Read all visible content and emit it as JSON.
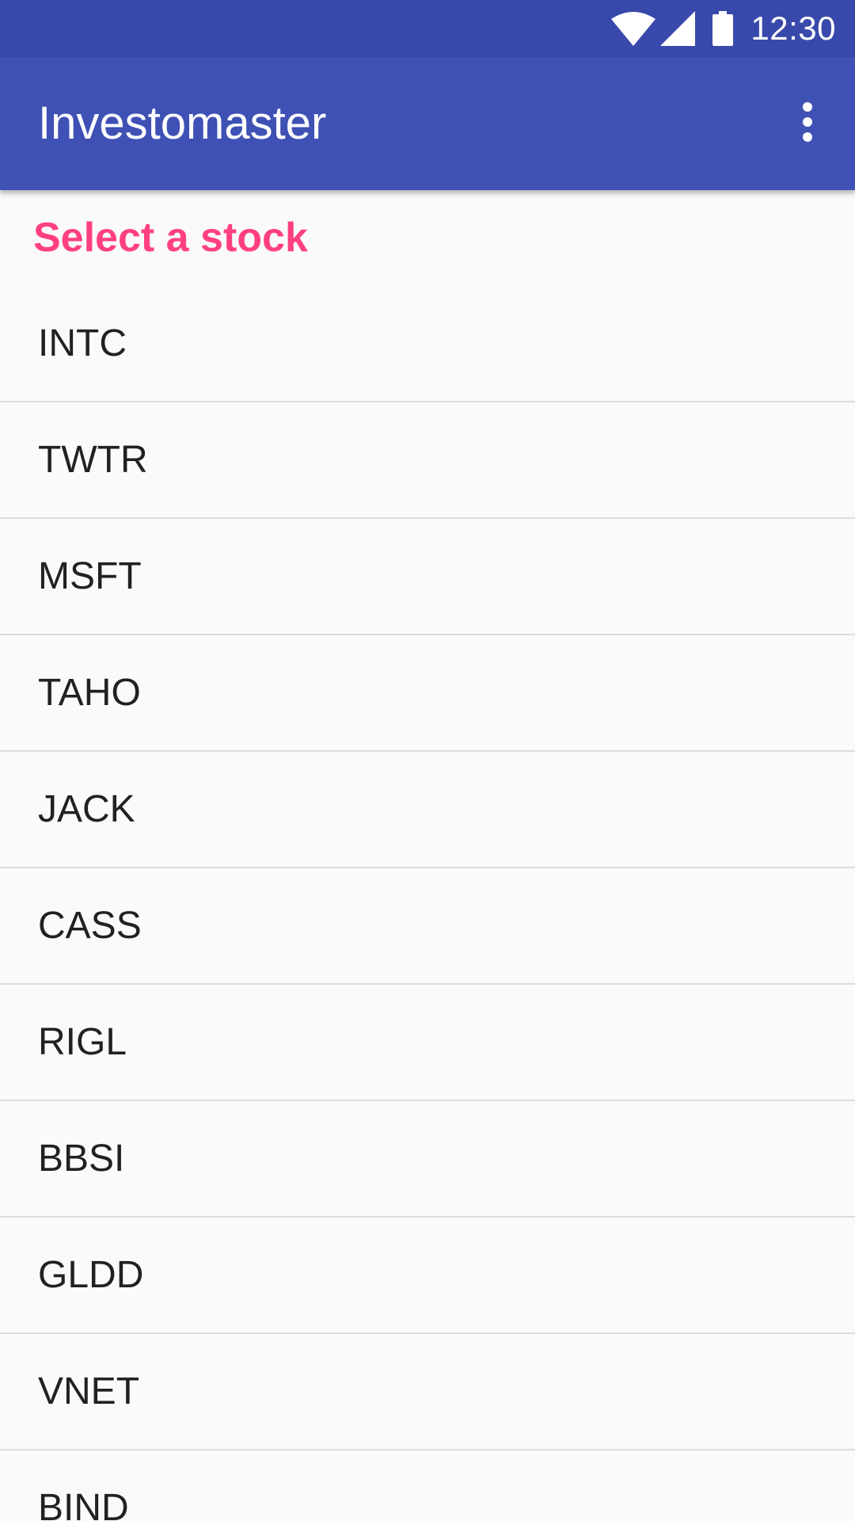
{
  "status_bar": {
    "time": "12:30",
    "icons": [
      "wifi-icon",
      "cell-signal-icon",
      "battery-icon"
    ],
    "background": "#3949ab"
  },
  "app_bar": {
    "title": "Investomaster",
    "overflow_icon": "more-vert-icon",
    "background": "#3f51b5"
  },
  "content": {
    "section_title": "Select a stock",
    "section_title_color": "#ff4081",
    "stocks": [
      "INTC",
      "TWTR",
      "MSFT",
      "TAHO",
      "JACK",
      "CASS",
      "RIGL",
      "BBSI",
      "GLDD",
      "VNET",
      "BIND"
    ]
  }
}
